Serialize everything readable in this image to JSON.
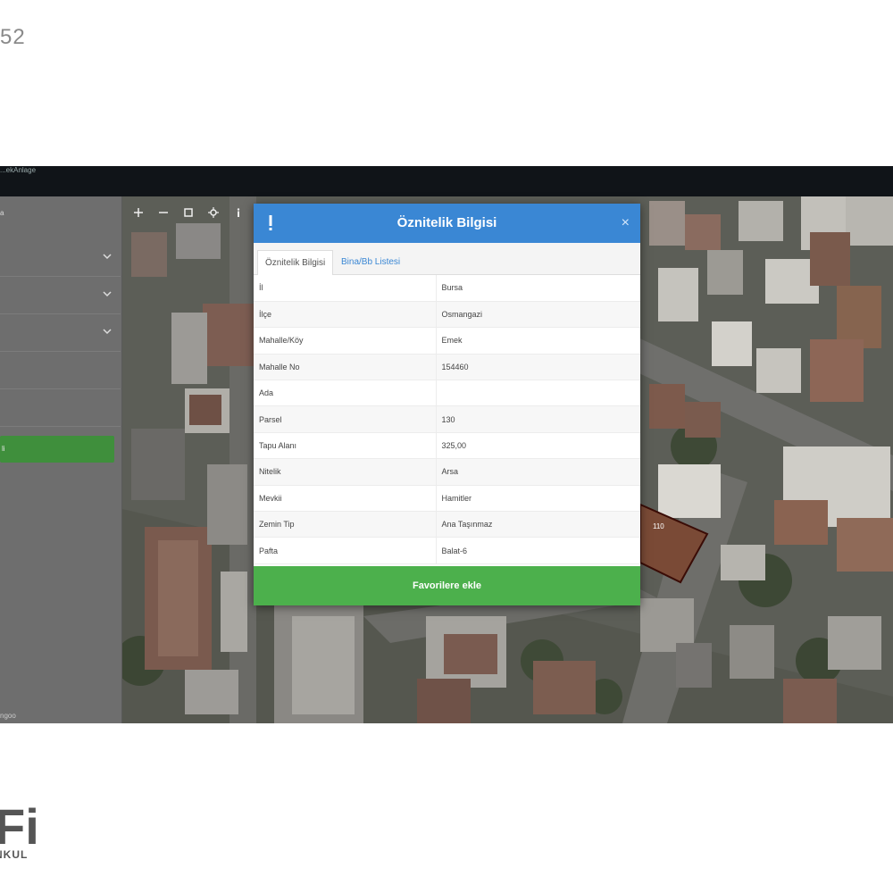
{
  "corner_number": "52",
  "brand": {
    "big": "Fi",
    "small": "NKUL"
  },
  "app": {
    "titlebar_text": "...ekAnlage",
    "left_panel": {
      "top_mark": "a",
      "green_button_label": "li",
      "footer_text": "ngoo"
    },
    "map_tools": [
      "plus-icon",
      "minus-icon",
      "fullscreen-icon",
      "locate-icon",
      "info-icon"
    ],
    "parcel_label": "110"
  },
  "dialog": {
    "title": "Öznitelik Bilgisi",
    "close_symbol": "×",
    "tabs": [
      {
        "label": "Öznitelik Bilgisi",
        "active": true
      },
      {
        "label": "Bina/Bb Listesi",
        "active": false
      }
    ],
    "rows": [
      {
        "key": "İl",
        "value": "Bursa"
      },
      {
        "key": "İlçe",
        "value": "Osmangazi"
      },
      {
        "key": "Mahalle/Köy",
        "value": "Emek"
      },
      {
        "key": "Mahalle No",
        "value": "154460"
      },
      {
        "key": "Ada",
        "value": ""
      },
      {
        "key": "Parsel",
        "value": "130"
      },
      {
        "key": "Tapu Alanı",
        "value": "325,00"
      },
      {
        "key": "Nitelik",
        "value": "Arsa"
      },
      {
        "key": "Mevkii",
        "value": "Hamitler"
      },
      {
        "key": "Zemin Tip",
        "value": "Ana Taşınmaz"
      },
      {
        "key": "Pafta",
        "value": "Balat-6"
      }
    ],
    "favorite_button": "Favorilere ekle"
  },
  "colors": {
    "dialog_header": "#3a87d4",
    "favorite_button": "#4cb04c",
    "panel_green": "#3f8f3c",
    "parcel_outline": "#3a0c06"
  }
}
